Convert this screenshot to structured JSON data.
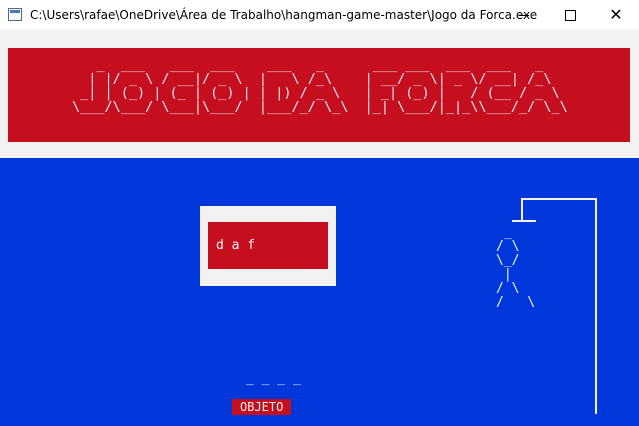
{
  "window": {
    "title": "C:\\Users\\rafae\\OneDrive\\Área de Trabalho\\hangman-game-master\\Jogo da Forca.exe",
    "minimize_glyph": "—",
    "maximize_glyph": "☐",
    "close_glyph": "✕"
  },
  "game": {
    "ascii_title": "   _  ___   ___  ___    ___   _      ___ ___  ___  ___   _   \n  | |/ _ \\ / __|/ _ \\  |   \\ /_\\    | __/ _ \\| _ \\/ __| /_\\  \n _| | (_) | (_ | (_) | | |) / _ \\   | _| (_) |   / (__ / _ \\ \n\\___/\\___/ \\___|\\___/  |___/_/ \\_\\  |_| \\___/|_|_\\\\___/_/ \\_\\",
    "used_letters": "d a f",
    "gallows_figure": "\n\n _\n/ \\\n\\_/\n |\n/ \\\n/   \\",
    "word_blanks": "_ _ _ _",
    "category": "OBJETO"
  },
  "colors": {
    "console_blue": "#0037da",
    "console_red": "#c50f1f",
    "console_white": "#f2f2f2"
  }
}
